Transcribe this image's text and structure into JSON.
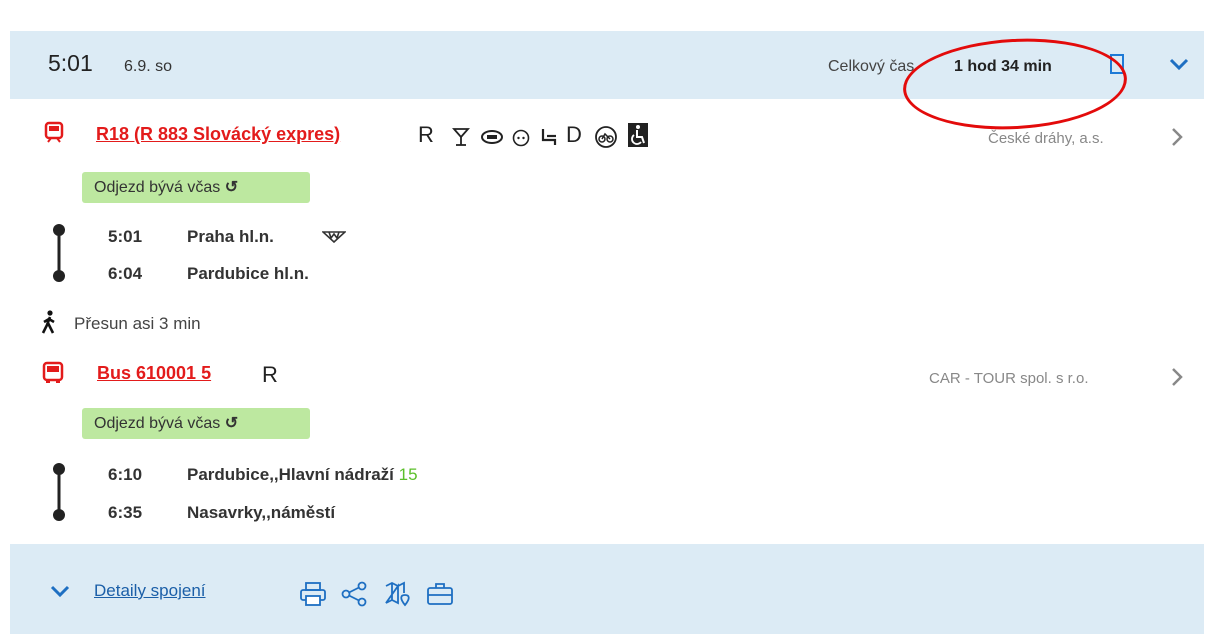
{
  "header": {
    "departure_time": "5:01",
    "date": "6.9. so",
    "total_label": "Celkový čas",
    "total_value": "1 hod 34 min"
  },
  "segments": [
    {
      "type": "train",
      "link": "R18 (R 883 Slovácký expres)",
      "amenity_letters": [
        "R",
        "D"
      ],
      "carrier": "České dráhy, a.s.",
      "badge": "Odjezd bývá včas",
      "stops": [
        {
          "time": "5:01",
          "name": "Praha hl.n.",
          "platform": ""
        },
        {
          "time": "6:04",
          "name": "Pardubice hl.n.",
          "platform": ""
        }
      ]
    },
    {
      "type": "bus",
      "link": "Bus 610001 5",
      "amenity_letters": [
        "R"
      ],
      "carrier": "CAR - TOUR spol. s r.o.",
      "badge": "Odjezd bývá včas",
      "stops": [
        {
          "time": "6:10",
          "name": "Pardubice,,Hlavní nádraží",
          "platform": "15"
        },
        {
          "time": "6:35",
          "name": "Nasavrky,,náměstí",
          "platform": ""
        }
      ]
    }
  ],
  "transfer": "Přesun asi 3 min",
  "footer": {
    "details_label": "Detaily spojení"
  },
  "colors": {
    "accent_red": "#e31b1b",
    "header_bg": "#dcebf5",
    "badge_bg": "#bde8a0",
    "link_blue": "#1b5fa8",
    "platform_green": "#5bbf2a"
  }
}
